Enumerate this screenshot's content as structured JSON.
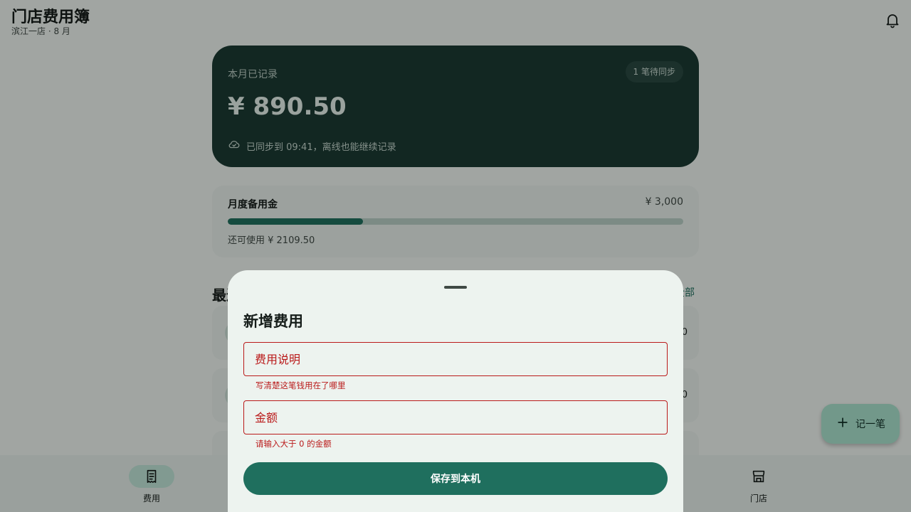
{
  "app": {
    "title": "门店费用簿",
    "subtitle": "滨江一店 · 8 月",
    "notification_icon": "bell-icon"
  },
  "summary": {
    "label": "本月已记录",
    "amount": "¥ 890.50",
    "pending_badge": "1 笔待同步",
    "sync_status": "已同步到 09:41，离线也能继续记录",
    "sync_icon": "cloud-done-icon",
    "background_color": "#1b3a33"
  },
  "reserve": {
    "label": "月度备用金",
    "total": "¥ 3,000",
    "remaining": "还可使用 ¥ 2109.50",
    "used_fraction": 0.297
  },
  "recent": {
    "title": "最近",
    "view_all": "全部",
    "rows": [
      {
        "amount": "0"
      },
      {
        "amount": "0"
      },
      {
        "amount": ""
      }
    ]
  },
  "fab": {
    "label": "记一笔",
    "icon": "plus-icon",
    "color": "#a9e0cc"
  },
  "bottom_nav": {
    "items": [
      {
        "label": "费用",
        "icon": "receipt-icon",
        "active": true
      },
      {
        "label": "门店",
        "icon": "store-icon",
        "active": false
      }
    ]
  },
  "sheet": {
    "title": "新增费用",
    "description_field": {
      "placeholder": "费用说明",
      "value": "",
      "error": "写清楚这笔钱用在了哪里"
    },
    "amount_field": {
      "placeholder": "金额",
      "value": "",
      "error": "请输入大于 0 的金额"
    },
    "save_button": "保存到本机",
    "accent_color": "#1f6f5e",
    "error_color": "#ba1a1a"
  }
}
